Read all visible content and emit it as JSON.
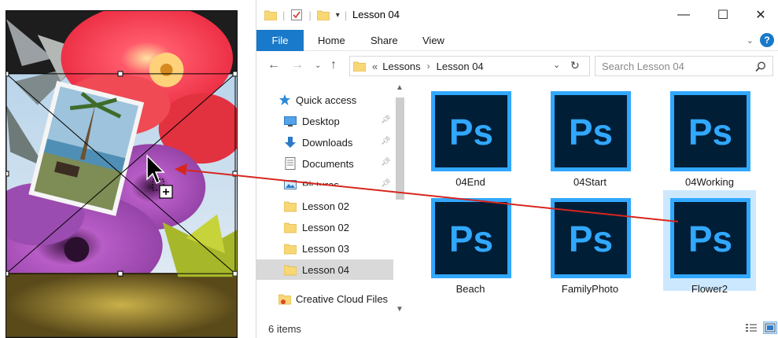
{
  "window": {
    "title": "Lesson 04",
    "minimize": "—",
    "maximize": "☐",
    "close": "✕"
  },
  "ribbon": {
    "tabs": [
      "File",
      "Home",
      "Share",
      "View"
    ]
  },
  "address": {
    "overflow": "«",
    "crumbs": [
      "Lessons",
      "Lesson 04"
    ],
    "search_placeholder": "Search Lesson 04"
  },
  "navpane": {
    "items": [
      {
        "label": "Quick access",
        "icon": "star-icon"
      },
      {
        "label": "Desktop",
        "icon": "desktop-icon",
        "pinned": true
      },
      {
        "label": "Downloads",
        "icon": "download-arrow-icon",
        "pinned": true
      },
      {
        "label": "Documents",
        "icon": "document-icon",
        "pinned": true
      },
      {
        "label": "Pictures",
        "icon": "pictures-icon",
        "pinned": true
      },
      {
        "label": "Lesson 02",
        "icon": "folder-icon"
      },
      {
        "label": "Lesson 02",
        "icon": "folder-icon"
      },
      {
        "label": "Lesson 03",
        "icon": "folder-icon"
      },
      {
        "label": "Lesson 04",
        "icon": "folder-icon",
        "selected": true
      },
      {
        "label": "Creative Cloud Files",
        "icon": "creative-cloud-folder-icon"
      }
    ]
  },
  "files": [
    {
      "name": "04End",
      "icon": "photoshop-file-icon",
      "icon_text": "Ps"
    },
    {
      "name": "04Start",
      "icon": "photoshop-file-icon",
      "icon_text": "Ps"
    },
    {
      "name": "04Working",
      "icon": "photoshop-file-icon",
      "icon_text": "Ps"
    },
    {
      "name": "Beach",
      "icon": "photoshop-file-icon",
      "icon_text": "Ps"
    },
    {
      "name": "FamilyPhoto",
      "icon": "photoshop-file-icon",
      "icon_text": "Ps"
    },
    {
      "name": "Flower2",
      "icon": "photoshop-file-icon",
      "icon_text": "Ps",
      "selected": true
    }
  ],
  "status": {
    "item_count": "6 items"
  },
  "colors": {
    "accent": "#1979ca",
    "ps_bg": "#001e36",
    "ps_border": "#31a8ff",
    "ps_text": "#31a8ff",
    "selection": "#cce8ff",
    "drag_arrow": "#d7261e"
  }
}
